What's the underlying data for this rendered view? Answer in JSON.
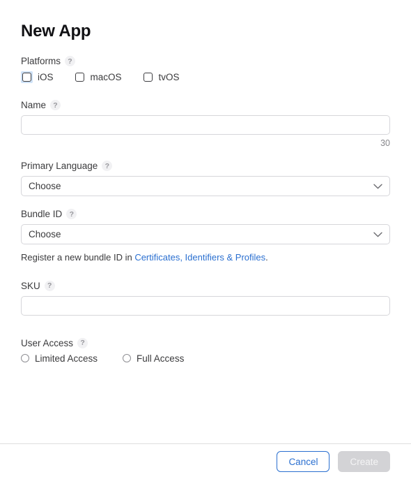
{
  "dialog": {
    "title": "New App"
  },
  "platforms": {
    "label": "Platforms",
    "help": "?",
    "options": [
      {
        "label": "iOS",
        "checked": false,
        "focused": true
      },
      {
        "label": "macOS",
        "checked": false,
        "focused": false
      },
      {
        "label": "tvOS",
        "checked": false,
        "focused": false
      }
    ]
  },
  "name": {
    "label": "Name",
    "help": "?",
    "value": "",
    "placeholder": "",
    "char_count": "30"
  },
  "primary_language": {
    "label": "Primary Language",
    "help": "?",
    "selected": "Choose",
    "chevron": "chevron-down-icon"
  },
  "bundle_id": {
    "label": "Bundle ID",
    "help": "?",
    "selected": "Choose",
    "chevron": "chevron-down-icon",
    "helper_prefix": "Register a new bundle ID in ",
    "helper_link": "Certificates, Identifiers & Profiles",
    "helper_suffix": "."
  },
  "sku": {
    "label": "SKU",
    "help": "?",
    "value": "",
    "placeholder": ""
  },
  "user_access": {
    "label": "User Access",
    "help": "?",
    "options": [
      {
        "label": "Limited Access",
        "selected": false
      },
      {
        "label": "Full Access",
        "selected": false
      }
    ]
  },
  "footer": {
    "cancel_label": "Cancel",
    "create_label": "Create"
  },
  "colors": {
    "link": "#2a6fd0",
    "accent": "#2a6fd0",
    "focus_ring": "#cfe2f7",
    "disabled_button": "#d3d3d6",
    "border": "#d6d6da",
    "text": "#3a3a3c"
  }
}
